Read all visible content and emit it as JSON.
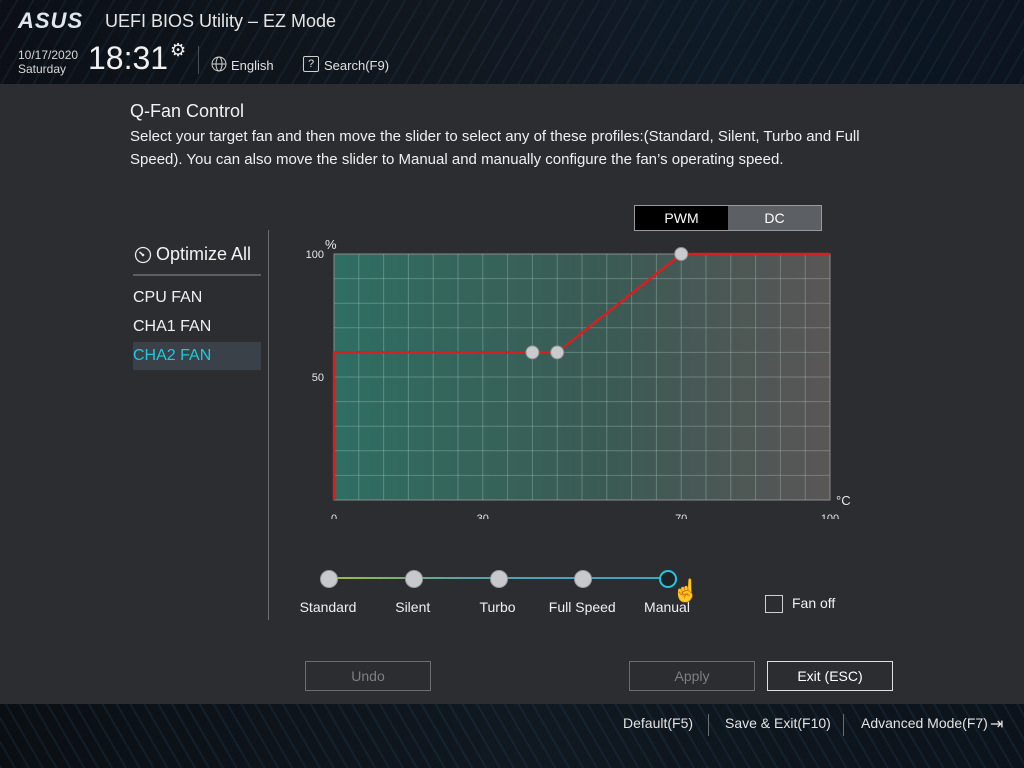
{
  "header": {
    "brand": "ASUS",
    "title": "UEFI BIOS Utility – EZ Mode",
    "date": "10/17/2020",
    "day": "Saturday",
    "time": "18:31",
    "language": "English",
    "search": "Search(F9)",
    "icons": {
      "settings": "gear-icon",
      "language": "globe-icon",
      "search": "question-box-icon"
    }
  },
  "qfan": {
    "title": "Q-Fan Control",
    "description": "Select your target fan and then move the slider to select any of these profiles:(Standard, Silent, Turbo and Full Speed). You can also move the slider to Manual and manually configure the fan’s operating speed.",
    "optimize_all": "Optimize All",
    "fans": [
      {
        "label": "CPU FAN",
        "selected": false
      },
      {
        "label": "CHA1 FAN",
        "selected": false
      },
      {
        "label": "CHA2 FAN",
        "selected": true
      }
    ],
    "mode_toggle": {
      "pwm": "PWM",
      "dc": "DC",
      "selected": "PWM"
    },
    "profiles": [
      "Standard",
      "Silent",
      "Turbo",
      "Full Speed",
      "Manual"
    ],
    "selected_profile": "Manual",
    "fan_off_label": "Fan off",
    "fan_off_checked": false,
    "buttons": {
      "undo": "Undo",
      "apply": "Apply",
      "exit": "Exit (ESC)"
    }
  },
  "chart_data": {
    "type": "line",
    "ylabel": "%",
    "xlabel": "°C",
    "xlim": [
      0,
      100
    ],
    "ylim": [
      0,
      100
    ],
    "xticks": [
      "0",
      "30",
      "70",
      "100"
    ],
    "yticks": [
      "50",
      "100"
    ],
    "grid": true,
    "series": [
      {
        "x": [
          0,
          0,
          40,
          45,
          70,
          100
        ],
        "y": [
          0,
          60,
          60,
          60,
          100,
          100
        ],
        "color": "#d42020"
      }
    ],
    "control_points": [
      {
        "x": 40,
        "y": 60
      },
      {
        "x": 45,
        "y": 60
      },
      {
        "x": 70,
        "y": 100
      }
    ]
  },
  "footer": {
    "default": "Default(F5)",
    "save_exit": "Save & Exit(F10)",
    "advanced": "Advanced Mode(F7)"
  },
  "colors": {
    "accent": "#1fc9df",
    "curve": "#d42020",
    "graph_bg": "#2f6e62"
  }
}
